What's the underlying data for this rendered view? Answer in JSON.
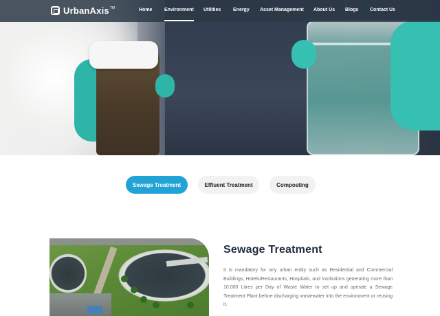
{
  "brand": {
    "name": "UrbanAxis",
    "tm": "TM"
  },
  "nav": {
    "items": [
      {
        "label": "Home",
        "active": false
      },
      {
        "label": "Environment",
        "active": true
      },
      {
        "label": "Utilities",
        "active": false
      },
      {
        "label": "Energy",
        "active": false
      },
      {
        "label": "Asset Management",
        "active": false
      },
      {
        "label": "About Us",
        "active": false
      },
      {
        "label": "Blogs",
        "active": false
      },
      {
        "label": "Contact Us",
        "active": false
      }
    ]
  },
  "tabs": [
    {
      "label": "Sewage Treatment",
      "active": true
    },
    {
      "label": "Effluent Treatment",
      "active": false
    },
    {
      "label": "Composting",
      "active": false
    }
  ],
  "content": {
    "title": "Sewage Treatment",
    "body": "It is mandatory for any urban entity such as Residential and Commercial Buildings, Hotels/Restaurants, Hospitals, and Institutions generating more than 10,000 Litres per Day of Waste Water to set up and operate a Sewage Treatment Plant before discharging wastewater into the environment or reusing it."
  },
  "colors": {
    "accent": "#21a3d6",
    "title": "#1f2a3d",
    "glove": "#35c0b1"
  }
}
